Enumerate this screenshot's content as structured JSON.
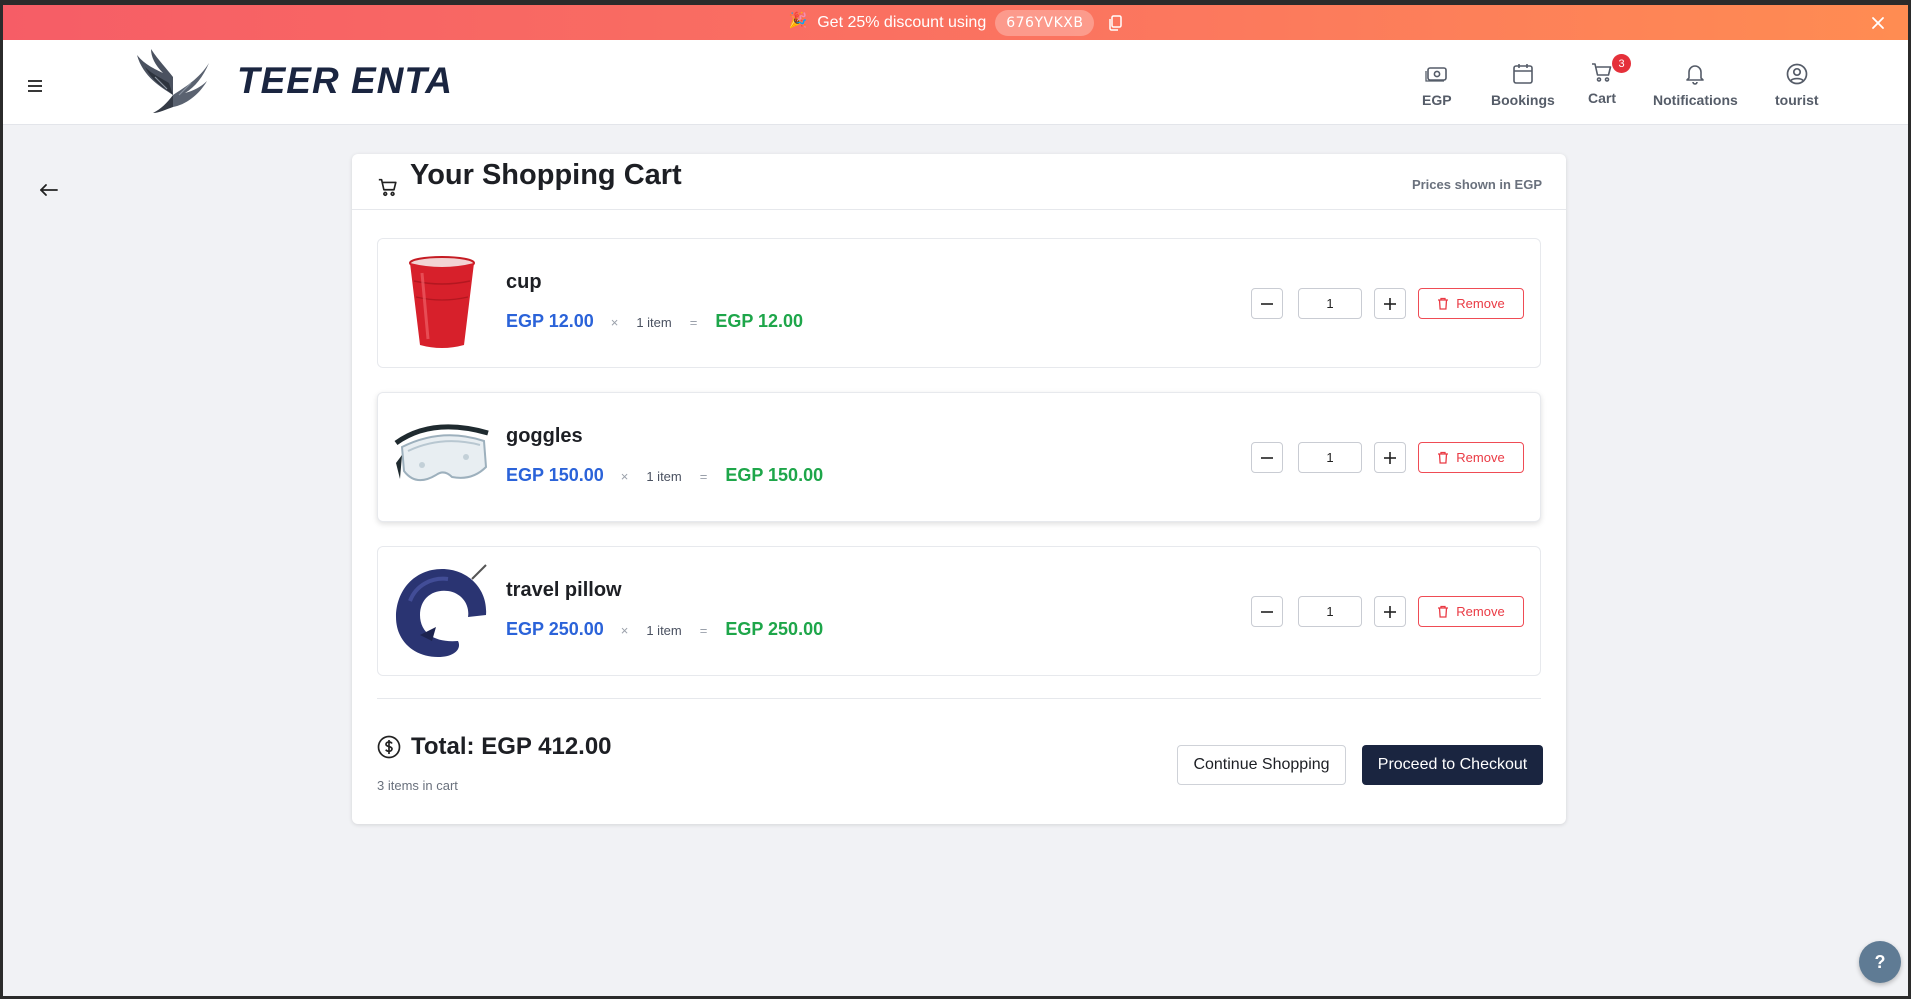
{
  "promo": {
    "emoji": "🎉",
    "text": "Get 25% discount using",
    "code": "676YVKXB"
  },
  "header": {
    "brand": "TEER ENTA",
    "nav": [
      {
        "label": "EGP",
        "icon": "currency-note-icon"
      },
      {
        "label": "Bookings",
        "icon": "calendar-icon"
      },
      {
        "label": "Cart",
        "icon": "cart-icon",
        "badge": "3"
      },
      {
        "label": "Notifications",
        "icon": "bell-icon"
      },
      {
        "label": "tourist",
        "icon": "user-circle-icon"
      }
    ]
  },
  "cart": {
    "title": "Your Shopping Cart",
    "prices_note": "Prices shown in EGP",
    "remove_label": "Remove",
    "items": [
      {
        "name": "cup",
        "unit_price": "EGP 12.00",
        "mult": "×",
        "count": "1 item",
        "eq": "=",
        "line_total": "EGP 12.00",
        "qty": "1"
      },
      {
        "name": "goggles",
        "unit_price": "EGP 150.00",
        "mult": "×",
        "count": "1 item",
        "eq": "=",
        "line_total": "EGP 150.00",
        "qty": "1"
      },
      {
        "name": "travel pillow",
        "unit_price": "EGP 250.00",
        "mult": "×",
        "count": "1 item",
        "eq": "=",
        "line_total": "EGP 250.00",
        "qty": "1"
      }
    ],
    "total": "Total: EGP 412.00",
    "items_in_cart": "3 items in cart",
    "continue_label": "Continue Shopping",
    "checkout_label": "Proceed to Checkout"
  },
  "help": {
    "label": "?"
  },
  "colors": {
    "accent_dark": "#1a2540",
    "price_blue": "#2b63d9",
    "total_green": "#1ea64a",
    "remove_red": "#ea3a44",
    "badge_red": "#e5303a",
    "promo_gradient_start": "#f65d66",
    "promo_gradient_end": "#ff8c52"
  }
}
